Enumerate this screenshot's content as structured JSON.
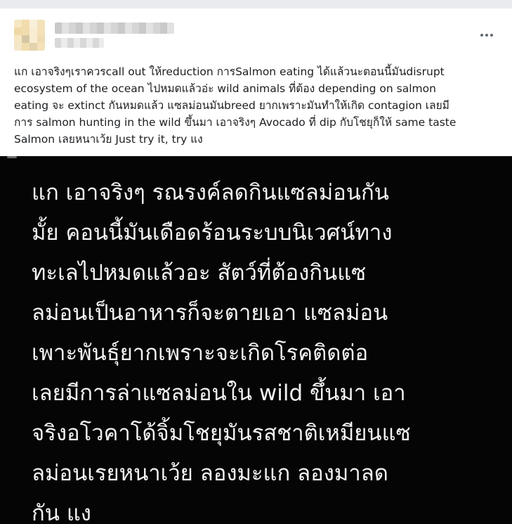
{
  "post": {
    "text": "แก เอาจริงๆเราควรcall out ให้reduction การSalmon eating ได้แล้วนะตอนนี้มันdisrupt\necosystem of the ocean ไปหมดแล้วอ่ะ wild animals ที่ต้อง depending on salmon\neating จะ extinct กันหมดแล้ว แซลม่อนมันbreed ยากเพราะมันทำให้เกิด contagion เลยมี\nการ salmon hunting in the wild ขึ้นมา เอาจริงๆ Avocado ที่ dip กับโชยุก็ให้ same taste\nSalmon เลยหนาเว้ย Just try it, try แง",
    "more_icon": "more-options-icon"
  },
  "image": {
    "text": "แก เอาจริงๆ รณรงค์ลดกินแซลม่อนกัน\nมั้ย คอนนี้มันเดือดร้อนระบบนิเวศน์ทาง\nทะเลไปหมดแล้วอะ สัตว์ที่ต้องกินแซ\nลม่อนเป็นอาหารก็จะตายเอา แซลม่อน\nเพาะพันธุ์ยากเพราะจะเกิดโรคติดต่อ\nเลยมีการล่าแซลม่อนใน wild ขึ้นมา เอา\nจริงอโวคาโด้จิ้มโชยุมันรสชาติเหมียนแซ\nลม่อนเรยหนาเว้ย ลองมะแก ลองมาลด\nกัน แง"
  },
  "colors": {
    "page_bg": "#e9ebee",
    "card_bg": "#ffffff",
    "text": "#1c1e21",
    "image_bg": "#050505",
    "image_text": "#f2f2f2"
  }
}
